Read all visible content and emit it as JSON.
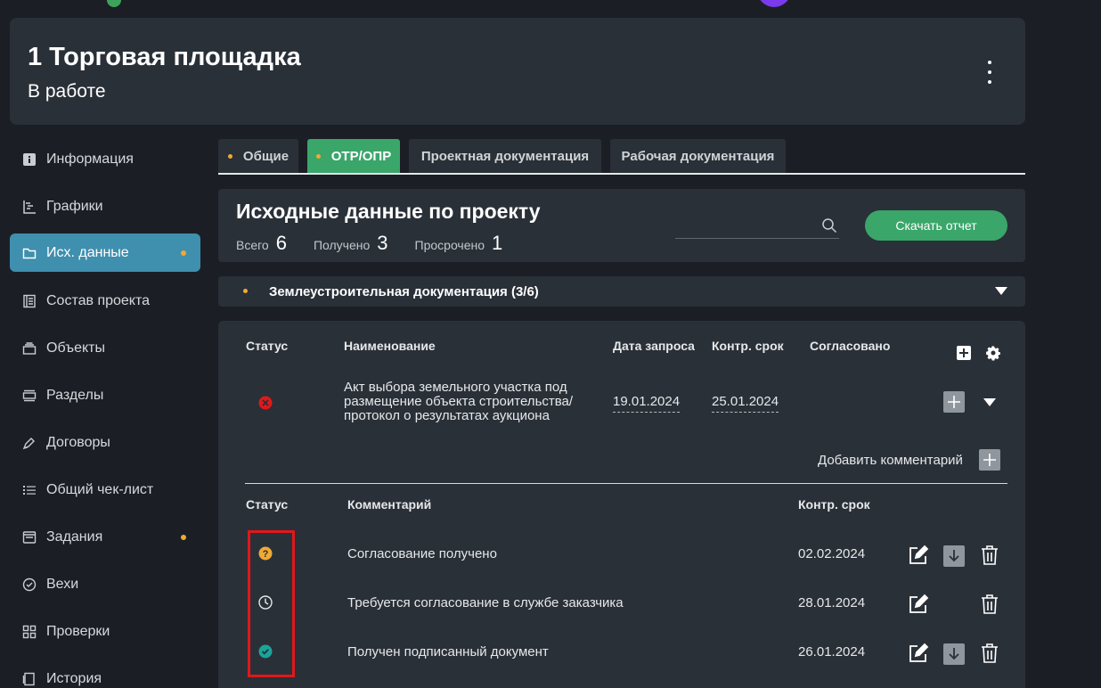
{
  "header": {
    "title": "1 Торговая площадка",
    "status": "В работе",
    "menu_icon": "kebab-menu-icon"
  },
  "sidebar": {
    "items": [
      {
        "label": "Информация",
        "icon": "info-icon"
      },
      {
        "label": "Графики",
        "icon": "gantt-icon"
      },
      {
        "label": "Исх. данные",
        "icon": "folder-icon",
        "active": true,
        "dot": true
      },
      {
        "label": "Состав проекта",
        "icon": "book-icon"
      },
      {
        "label": "Объекты",
        "icon": "layers-icon"
      },
      {
        "label": "Разделы",
        "icon": "sections-icon"
      },
      {
        "label": "Договоры",
        "icon": "pen-icon"
      },
      {
        "label": "Общий чек-лист",
        "icon": "list-icon"
      },
      {
        "label": "Задания",
        "icon": "tasks-icon",
        "dot": true
      },
      {
        "label": "Вехи",
        "icon": "check-circle-icon"
      },
      {
        "label": "Проверки",
        "icon": "grid-icon"
      },
      {
        "label": "История",
        "icon": "history-icon"
      }
    ]
  },
  "tabs": [
    {
      "label": "Общие",
      "dot": true
    },
    {
      "label": "ОТР/ОПР",
      "dot": true,
      "active": true
    },
    {
      "label": "Проектная документация"
    },
    {
      "label": "Рабочая документация"
    }
  ],
  "summary": {
    "title": "Исходные данные по проекту",
    "total_label": "Всего",
    "total_value": "6",
    "received_label": "Получено",
    "received_value": "3",
    "overdue_label": "Просрочено",
    "overdue_value": "1",
    "search_placeholder": "",
    "download_label": "Скачать отчет"
  },
  "accordion": {
    "title": "Землеустроительная документация (3/6)"
  },
  "table": {
    "headers": {
      "status": "Статус",
      "name": "Наименование",
      "request_date": "Дата запроса",
      "deadline": "Контр. срок",
      "approved": "Согласовано"
    },
    "row": {
      "status": "rejected",
      "name_line1": "Акт выбора земельного участка под",
      "name_line2": "размещение объекта строительства/",
      "name_line3": "протокол о результатах аукциона",
      "request_date": "19.01.2024",
      "deadline": "25.01.2024",
      "approved": ""
    },
    "add_comment_label": "Добавить комментарий"
  },
  "comments": {
    "headers": {
      "status": "Статус",
      "comment": "Комментарий",
      "deadline": "Контр. срок"
    },
    "rows": [
      {
        "status": "question",
        "text": "Согласование получено",
        "deadline": "02.02.2024",
        "download": true
      },
      {
        "status": "pending",
        "text": "Требуется согласование в службе заказчика",
        "deadline": "28.01.2024",
        "download": false
      },
      {
        "status": "done",
        "text": "Получен подписанный документ",
        "deadline": "26.01.2024",
        "download": true
      }
    ]
  },
  "colors": {
    "accent_green": "#3aa66a",
    "active_blue": "#3f8fae",
    "dot_orange": "#f0a932",
    "error_red": "#e0181b",
    "teal": "#1aa59a"
  }
}
